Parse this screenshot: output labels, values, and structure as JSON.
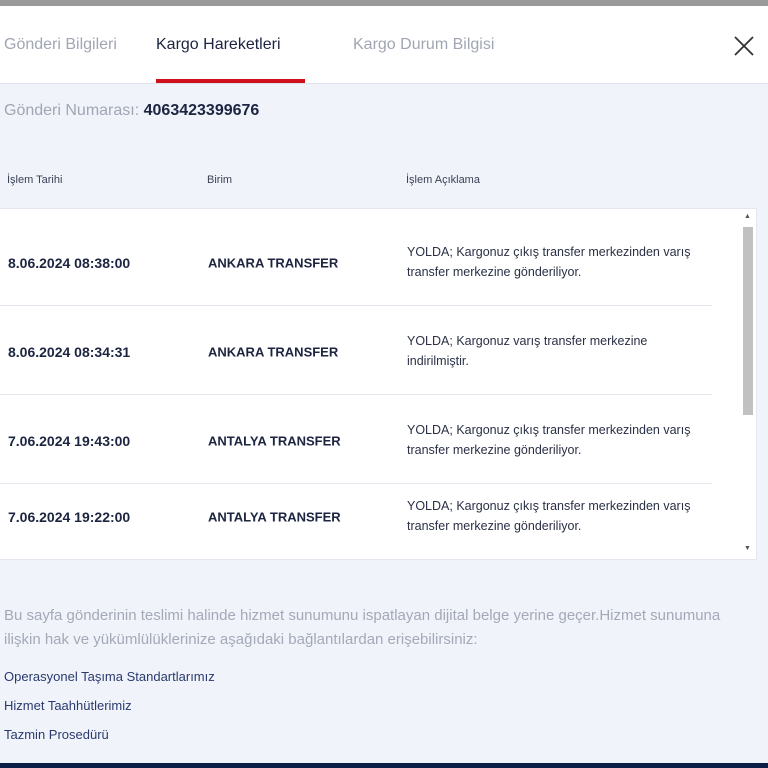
{
  "tabs": [
    {
      "label": "Gönderi Bilgileri"
    },
    {
      "label": "Kargo Hareketleri"
    },
    {
      "label": "Kargo Durum Bilgisi"
    }
  ],
  "shipment": {
    "label": "Gönderi Numarası:",
    "number": "4063423399676"
  },
  "columns": [
    "İşlem Tarihi",
    "Birim",
    "İşlem Açıklama"
  ],
  "rows": [
    {
      "date": "8.06.2024 08:38:00",
      "unit": "ANKARA TRANSFER",
      "desc": "YOLDA; Kargonuz çıkış transfer merkezinden varış transfer merkezine gönderiliyor."
    },
    {
      "date": "8.06.2024 08:34:31",
      "unit": "ANKARA TRANSFER",
      "desc": "YOLDA; Kargonuz varış transfer merkezine indirilmiştir."
    },
    {
      "date": "7.06.2024 19:43:00",
      "unit": "ANTALYA TRANSFER",
      "desc": "YOLDA; Kargonuz çıkış transfer merkezinden varış transfer merkezine gönderiliyor."
    },
    {
      "date": "7.06.2024 19:22:00",
      "unit": "ANTALYA TRANSFER",
      "desc": "YOLDA; Kargonuz çıkış transfer merkezinden varış transfer merkezine gönderiliyor."
    }
  ],
  "note": "Bu sayfa gönderinin teslimi halinde hizmet sunumunu ispatlayan dijital belge yerine geçer.Hizmet sunumuna ilişkin hak ve yükümlülüklerinize aşağıdaki bağlantılardan erişebilirsiniz:",
  "links": [
    "Operasyonel Taşıma Standartlarımız",
    "Hizmet Taahhütlerimiz",
    "Tazmin Prosedürü"
  ],
  "colors": {
    "accent": "#d0101a",
    "text": "#1c2440",
    "footer": "#0b1e45"
  }
}
